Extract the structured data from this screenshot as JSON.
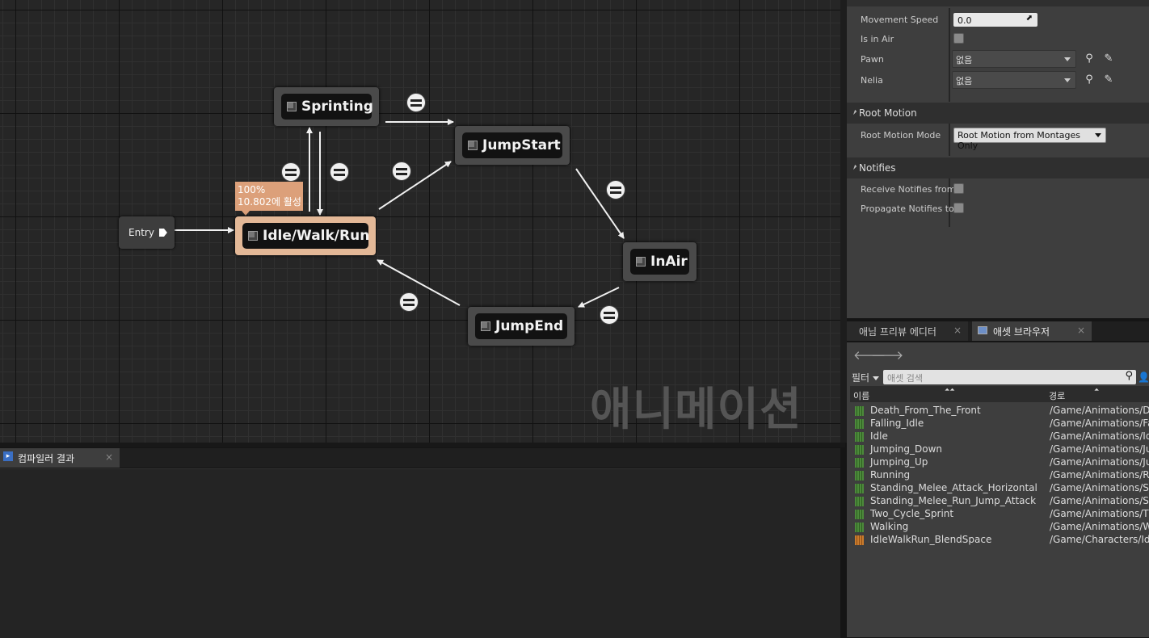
{
  "graph": {
    "watermark": "애니메이션",
    "entry_label": "Entry",
    "tooltip_line1": "100%",
    "tooltip_line2": "10.802에 활성",
    "states": {
      "sprinting": "Sprinting",
      "idle": "Idle/Walk/Run",
      "jumpstart": "JumpStart",
      "inair": "InAir",
      "jumpend": "JumpEnd"
    }
  },
  "details": {
    "movement_speed_label": "Movement Speed",
    "movement_speed_value": "0.0",
    "is_in_air_label": "Is in Air",
    "pawn_label": "Pawn",
    "pawn_value": "없음",
    "nelia_label": "Nelia",
    "nelia_value": "없음",
    "root_motion_section": "Root Motion",
    "root_motion_mode_label": "Root Motion Mode",
    "root_motion_mode_value": "Root Motion from Montages Only",
    "notifies_section": "Notifies",
    "receive_notifies_label": "Receive Notifies from",
    "propagate_notifies_label": "Propagate Notifies to"
  },
  "tabs": {
    "compiler_results": "컴파일러 결과",
    "anim_preview_editor": "애님 프리뷰 에디터",
    "asset_browser": "애셋 브라우저"
  },
  "asset_browser": {
    "filter_label": "필터",
    "search_placeholder": "애셋 검색",
    "col_name": "이름",
    "col_path": "경로",
    "rows": [
      {
        "name": "Death_From_The_Front",
        "path": "/Game/Animations/De"
      },
      {
        "name": "Falling_Idle",
        "path": "/Game/Animations/Fa"
      },
      {
        "name": "Idle",
        "path": "/Game/Animations/Idl"
      },
      {
        "name": "Jumping_Down",
        "path": "/Game/Animations/Ju"
      },
      {
        "name": "Jumping_Up",
        "path": "/Game/Animations/Ju"
      },
      {
        "name": "Running",
        "path": "/Game/Animations/Ru"
      },
      {
        "name": "Standing_Melee_Attack_Horizontal",
        "path": "/Game/Animations/St"
      },
      {
        "name": "Standing_Melee_Run_Jump_Attack",
        "path": "/Game/Animations/St"
      },
      {
        "name": "Two_Cycle_Sprint",
        "path": "/Game/Animations/Tv"
      },
      {
        "name": "Walking",
        "path": "/Game/Animations/Wa"
      },
      {
        "name": "IdleWalkRun_BlendSpace",
        "path": "/Game/Characters/Idl"
      }
    ]
  }
}
